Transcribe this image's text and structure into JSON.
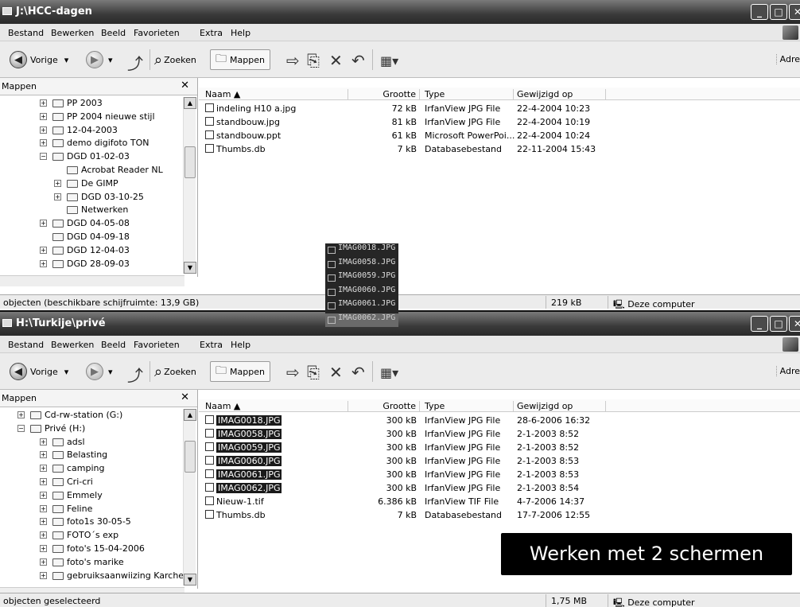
{
  "menu": [
    "Bestand",
    "Bewerken",
    "Beeld",
    "Favorieten",
    "Extra",
    "Help"
  ],
  "toolbar": {
    "back": "Vorige",
    "search": "Zoeken",
    "folders": "Mappen",
    "address": "Adre"
  },
  "pane_title": "Mappen",
  "columns": {
    "name": "Naam ▲",
    "size": "Grootte",
    "type": "Type",
    "modified": "Gewijzigd op"
  },
  "win1": {
    "title": "J:\\HCC-dagen",
    "tree": [
      {
        "label": "PP 2003",
        "level": 2,
        "pm": "+"
      },
      {
        "label": "PP 2004 nieuwe stijl",
        "level": 2,
        "pm": "+"
      },
      {
        "label": "12-04-2003",
        "level": 2,
        "pm": "+"
      },
      {
        "label": "demo digifoto TON",
        "level": 2,
        "pm": "+"
      },
      {
        "label": "DGD 01-02-03",
        "level": 2,
        "pm": "−"
      },
      {
        "label": "Acrobat Reader NL",
        "level": 3,
        "pm": ""
      },
      {
        "label": "De GIMP",
        "level": 3,
        "pm": "+"
      },
      {
        "label": "DGD 03-10-25",
        "level": 3,
        "pm": "+"
      },
      {
        "label": "Netwerken",
        "level": 3,
        "pm": ""
      },
      {
        "label": "DGD 04-05-08",
        "level": 2,
        "pm": "+"
      },
      {
        "label": "DGD 04-09-18",
        "level": 2,
        "pm": ""
      },
      {
        "label": "DGD 12-04-03",
        "level": 2,
        "pm": "+"
      },
      {
        "label": "DGD 28-09-03",
        "level": 2,
        "pm": "+"
      }
    ],
    "files": [
      {
        "name": "indeling H10 a.jpg",
        "size": "72 kB",
        "type": "IrfanView JPG File",
        "modified": "22-4-2004 10:23"
      },
      {
        "name": "standbouw.jpg",
        "size": "81 kB",
        "type": "IrfanView JPG File",
        "modified": "22-4-2004 10:19"
      },
      {
        "name": "standbouw.ppt",
        "size": "61 kB",
        "type": "Microsoft PowerPoi...",
        "modified": "22-4-2004 10:24"
      },
      {
        "name": "Thumbs.db",
        "size": "7 kB",
        "type": "Databasebestand",
        "modified": "22-11-2004 15:43"
      }
    ],
    "status": {
      "left": "objecten (beschikbare schijfruimte: 13,9 GB)",
      "size": "219 kB",
      "zone": "Deze computer"
    }
  },
  "drag_items": [
    "IMAG0018.JPG",
    "IMAG0058.JPG",
    "IMAG0059.JPG",
    "IMAG0060.JPG",
    "IMAG0061.JPG",
    "IMAG0062.JPG"
  ],
  "win2": {
    "title": "H:\\Turkije\\privé",
    "tree": [
      {
        "label": "Cd-rw-station (G:)",
        "level": 1,
        "pm": "+"
      },
      {
        "label": "Privé (H:)",
        "level": 1,
        "pm": "−"
      },
      {
        "label": "adsl",
        "level": 2,
        "pm": "+"
      },
      {
        "label": "Belasting",
        "level": 2,
        "pm": "+"
      },
      {
        "label": "camping",
        "level": 2,
        "pm": "+"
      },
      {
        "label": "Cri-cri",
        "level": 2,
        "pm": "+"
      },
      {
        "label": "Emmely",
        "level": 2,
        "pm": "+"
      },
      {
        "label": "Feline",
        "level": 2,
        "pm": "+"
      },
      {
        "label": "foto1s 30-05-5",
        "level": 2,
        "pm": "+"
      },
      {
        "label": "FOTO´s exp",
        "level": 2,
        "pm": "+"
      },
      {
        "label": "foto's 15-04-2006",
        "level": 2,
        "pm": "+"
      },
      {
        "label": "foto's marike",
        "level": 2,
        "pm": "+"
      },
      {
        "label": "gebruiksaanwiizing Karcher",
        "level": 2,
        "pm": "+"
      }
    ],
    "files": [
      {
        "name": "IMAG0018.JPG",
        "size": "300 kB",
        "type": "IrfanView JPG File",
        "modified": "28-6-2006 16:32",
        "selected": true
      },
      {
        "name": "IMAG0058.JPG",
        "size": "300 kB",
        "type": "IrfanView JPG File",
        "modified": "2-1-2003 8:52",
        "selected": true
      },
      {
        "name": "IMAG0059.JPG",
        "size": "300 kB",
        "type": "IrfanView JPG File",
        "modified": "2-1-2003 8:52",
        "selected": true
      },
      {
        "name": "IMAG0060.JPG",
        "size": "300 kB",
        "type": "IrfanView JPG File",
        "modified": "2-1-2003 8:53",
        "selected": true
      },
      {
        "name": "IMAG0061.JPG",
        "size": "300 kB",
        "type": "IrfanView JPG File",
        "modified": "2-1-2003 8:53",
        "selected": true
      },
      {
        "name": "IMAG0062.JPG",
        "size": "300 kB",
        "type": "IrfanView JPG File",
        "modified": "2-1-2003 8:54",
        "selected": true
      },
      {
        "name": "Nieuw-1.tif",
        "size": "6.386 kB",
        "type": "IrfanView TIF File",
        "modified": "4-7-2006 14:37",
        "selected": false
      },
      {
        "name": "Thumbs.db",
        "size": "7 kB",
        "type": "Databasebestand",
        "modified": "17-7-2006 12:55",
        "selected": false
      }
    ],
    "status": {
      "left": "objecten geselecteerd",
      "size": "1,75 MB",
      "zone": "Deze computer"
    }
  },
  "banner": "Werken met 2 schermen"
}
